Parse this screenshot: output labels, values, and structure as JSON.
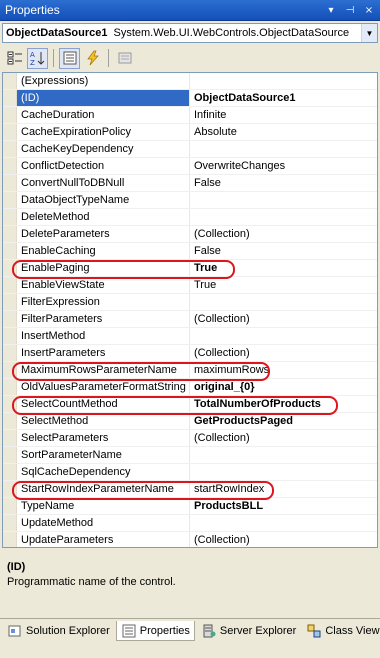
{
  "window": {
    "title": "Properties",
    "controls": [
      "▾",
      "⊣",
      "×"
    ]
  },
  "object_selector": {
    "name": "ObjectDataSource1",
    "type": "System.Web.UI.WebControls.ObjectDataSource"
  },
  "toolbar": {
    "buttons": [
      "categorized-icon",
      "alphabetical-icon",
      "properties-icon",
      "events-icon",
      "property-pages-icon"
    ]
  },
  "properties": [
    {
      "name": "(Expressions)",
      "value": ""
    },
    {
      "name": "(ID)",
      "value": "ObjectDataSource1",
      "selected": true,
      "bold": true
    },
    {
      "name": "CacheDuration",
      "value": "Infinite"
    },
    {
      "name": "CacheExpirationPolicy",
      "value": "Absolute"
    },
    {
      "name": "CacheKeyDependency",
      "value": ""
    },
    {
      "name": "ConflictDetection",
      "value": "OverwriteChanges"
    },
    {
      "name": "ConvertNullToDBNull",
      "value": "False"
    },
    {
      "name": "DataObjectTypeName",
      "value": ""
    },
    {
      "name": "DeleteMethod",
      "value": ""
    },
    {
      "name": "DeleteParameters",
      "value": "(Collection)"
    },
    {
      "name": "EnableCaching",
      "value": "False"
    },
    {
      "name": "EnablePaging",
      "value": "True",
      "bold": true
    },
    {
      "name": "EnableViewState",
      "value": "True"
    },
    {
      "name": "FilterExpression",
      "value": ""
    },
    {
      "name": "FilterParameters",
      "value": "(Collection)"
    },
    {
      "name": "InsertMethod",
      "value": ""
    },
    {
      "name": "InsertParameters",
      "value": "(Collection)"
    },
    {
      "name": "MaximumRowsParameterName",
      "value": "maximumRows"
    },
    {
      "name": "OldValuesParameterFormatString",
      "value": "original_{0}",
      "bold": true
    },
    {
      "name": "SelectCountMethod",
      "value": "TotalNumberOfProducts",
      "bold": true
    },
    {
      "name": "SelectMethod",
      "value": "GetProductsPaged",
      "bold": true
    },
    {
      "name": "SelectParameters",
      "value": "(Collection)"
    },
    {
      "name": "SortParameterName",
      "value": ""
    },
    {
      "name": "SqlCacheDependency",
      "value": ""
    },
    {
      "name": "StartRowIndexParameterName",
      "value": "startRowIndex"
    },
    {
      "name": "TypeName",
      "value": "ProductsBLL",
      "bold": true
    },
    {
      "name": "UpdateMethod",
      "value": ""
    },
    {
      "name": "UpdateParameters",
      "value": "(Collection)"
    }
  ],
  "description": {
    "title": "(ID)",
    "text": "Programmatic name of the control."
  },
  "tabs": [
    {
      "label": "Solution Explorer",
      "icon": "solution-explorer-icon"
    },
    {
      "label": "Properties",
      "icon": "properties-icon",
      "active": true
    },
    {
      "label": "Server Explorer",
      "icon": "server-explorer-icon"
    },
    {
      "label": "Class View",
      "icon": "class-view-icon"
    }
  ],
  "colors": {
    "title_bar": "#1f5fc6",
    "selection": "#316ac5",
    "highlight": "#e0141c"
  }
}
